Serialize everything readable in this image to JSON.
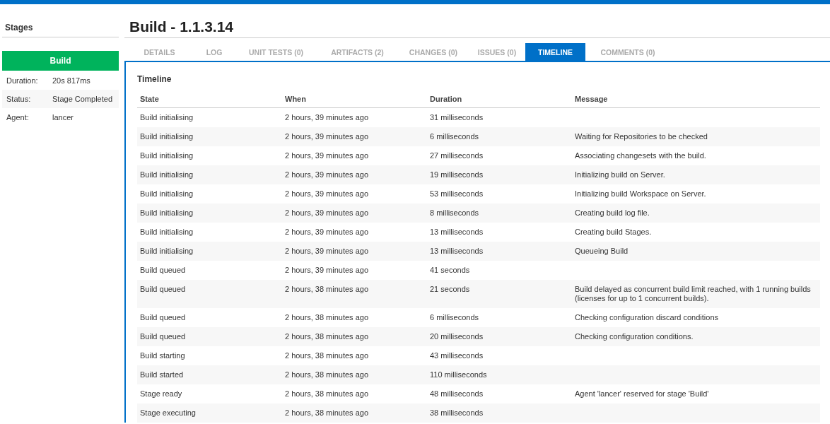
{
  "sidebar": {
    "title": "Stages",
    "stage": {
      "label": "Build"
    },
    "details": [
      {
        "label": "Duration:",
        "value": "20s 817ms"
      },
      {
        "label": "Status:",
        "value": "Stage Completed"
      },
      {
        "label": "Agent:",
        "value": "lancer"
      }
    ]
  },
  "page_title": "Build - 1.1.3.14",
  "tabs": [
    {
      "label": "DETAILS",
      "selected": false
    },
    {
      "label": "LOG",
      "selected": false
    },
    {
      "label": "UNIT TESTS (0)",
      "selected": false
    },
    {
      "label": "ARTIFACTS (2)",
      "selected": false
    },
    {
      "label": "CHANGES (0)",
      "selected": false
    },
    {
      "label": "ISSUES (0)",
      "selected": false
    },
    {
      "label": "TIMELINE",
      "selected": true
    },
    {
      "label": "COMMENTS (0)",
      "selected": false
    }
  ],
  "timeline": {
    "title": "Timeline",
    "columns": [
      "State",
      "When",
      "Duration",
      "Message"
    ],
    "rows": [
      [
        "Build initialising",
        "2 hours, 39 minutes ago",
        "31 milliseconds",
        ""
      ],
      [
        "Build initialising",
        "2 hours, 39 minutes ago",
        "6 milliseconds",
        "Waiting for Repositories to be checked"
      ],
      [
        "Build initialising",
        "2 hours, 39 minutes ago",
        "27 milliseconds",
        "Associating changesets with the build."
      ],
      [
        "Build initialising",
        "2 hours, 39 minutes ago",
        "19 milliseconds",
        "Initializing build on Server."
      ],
      [
        "Build initialising",
        "2 hours, 39 minutes ago",
        "53 milliseconds",
        "Initializing build Workspace on Server."
      ],
      [
        "Build initialising",
        "2 hours, 39 minutes ago",
        "8 milliseconds",
        "Creating build log file."
      ],
      [
        "Build initialising",
        "2 hours, 39 minutes ago",
        "13 milliseconds",
        "Creating build Stages."
      ],
      [
        "Build initialising",
        "2 hours, 39 minutes ago",
        "13 milliseconds",
        "Queueing Build"
      ],
      [
        "Build queued",
        "2 hours, 39 minutes ago",
        "41 seconds",
        ""
      ],
      [
        "Build queued",
        "2 hours, 38 minutes ago",
        "21 seconds",
        "Build delayed as concurrent build limit reached, with 1 running builds (licenses for up to 1 concurrent builds)."
      ],
      [
        "Build queued",
        "2 hours, 38 minutes ago",
        "6 milliseconds",
        "Checking configuration discard conditions"
      ],
      [
        "Build queued",
        "2 hours, 38 minutes ago",
        "20 milliseconds",
        "Checking configuration conditions."
      ],
      [
        "Build starting",
        "2 hours, 38 minutes ago",
        "43 milliseconds",
        ""
      ],
      [
        "Build started",
        "2 hours, 38 minutes ago",
        "110 milliseconds",
        ""
      ],
      [
        "Stage ready",
        "2 hours, 38 minutes ago",
        "48 milliseconds",
        "Agent 'lancer' reserved for stage 'Build'"
      ],
      [
        "Stage executing",
        "2 hours, 38 minutes ago",
        "38 milliseconds",
        ""
      ]
    ]
  }
}
